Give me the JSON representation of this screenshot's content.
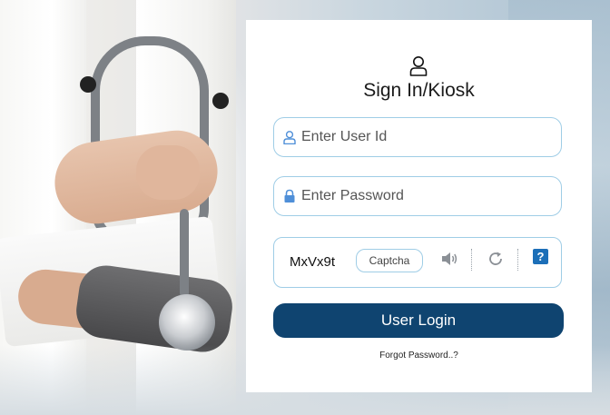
{
  "login": {
    "title": "Sign In/Kiosk",
    "user_id_placeholder": "Enter User Id",
    "password_placeholder": "Enter Password",
    "captcha_code": "MxVx9t",
    "captcha_placeholder": "Captcha",
    "login_label": "User Login",
    "forgot_label": "Forgot Password..?",
    "help_label": "?"
  },
  "icons": {
    "header": "user-outline-icon",
    "user_field": "user-outline-icon",
    "password_field": "lock-icon",
    "audio": "speaker-icon",
    "refresh": "refresh-icon",
    "help": "question-icon"
  },
  "colors": {
    "accent": "#0f4470",
    "field_border": "#9fcde6",
    "icon_blue": "#4f8fd8",
    "help_blue": "#1c6fb8"
  }
}
